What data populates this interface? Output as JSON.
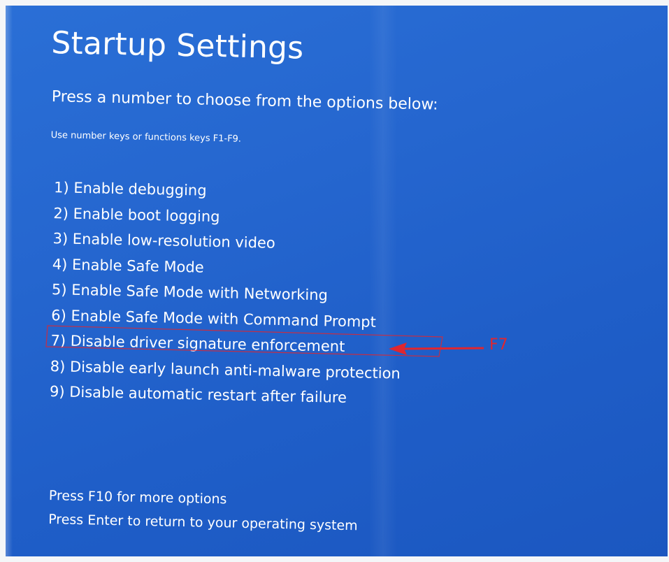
{
  "screen": {
    "title": "Startup Settings",
    "subtitle": "Press a number to choose from the options below:",
    "hint": "Use number keys or functions keys F1-F9.",
    "options": [
      {
        "label": "1) Enable debugging"
      },
      {
        "label": "2) Enable boot logging"
      },
      {
        "label": "3) Enable low-resolution video"
      },
      {
        "label": "4) Enable Safe Mode"
      },
      {
        "label": "5) Enable Safe Mode with Networking"
      },
      {
        "label": "6) Enable Safe Mode with Command Prompt"
      },
      {
        "label": "7) Disable driver signature enforcement"
      },
      {
        "label": "8) Disable early launch anti-malware protection"
      },
      {
        "label": "9) Disable automatic restart after failure"
      }
    ],
    "footer": {
      "more_options": "Press F10 for more options",
      "return": "Press Enter to return to your operating system"
    }
  },
  "annotation": {
    "label": "F7",
    "color": "#e0262f"
  },
  "colors": {
    "background": "#2566cf",
    "text": "#ffffff"
  }
}
